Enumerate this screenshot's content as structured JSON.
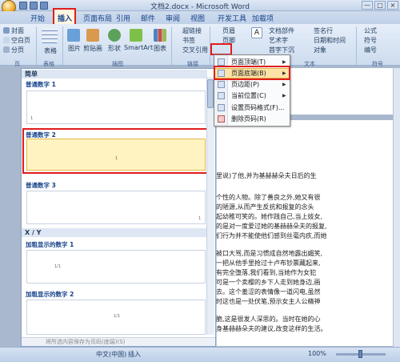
{
  "window": {
    "title": "文档2.docx - Microsoft Word",
    "controls": [
      "—",
      "□",
      "×"
    ]
  },
  "tabs": [
    "开始",
    "插入",
    "页面布局",
    "引用",
    "邮件",
    "审阅",
    "视图",
    "开发工具",
    "加载项"
  ],
  "ribbon": {
    "pages_group": [
      "封面",
      "空白页",
      "分页"
    ],
    "table_label": "表格",
    "illustrations": [
      "图片",
      "剪贴画",
      "形状",
      "SmartArt",
      "图表"
    ],
    "links_group": [
      "超链接",
      "书签",
      "交叉引用"
    ],
    "header_footer": [
      "页眉",
      "页脚"
    ],
    "text_group": [
      "文本框",
      "文档部件",
      "艺术字",
      "首字下沉"
    ],
    "text_right": [
      "签名行",
      "日期和时间",
      "对象"
    ],
    "symbols_group": [
      "公式",
      "符号",
      "编号"
    ],
    "group_labels": [
      "页",
      "表格",
      "插图",
      "链接",
      "文本",
      "符号"
    ]
  },
  "menu": {
    "items": [
      {
        "label": "页面顶端(T)",
        "arrow": "▶"
      },
      {
        "label": "页面底端(B)",
        "arrow": "▶"
      },
      {
        "label": "页边距(P)",
        "arrow": "▶"
      },
      {
        "label": "当前位置(C)",
        "arrow": "▶"
      },
      {
        "label": "设置页码格式(F)...",
        "arrow": ""
      },
      {
        "label": "删除页码(R)",
        "arrow": ""
      }
    ]
  },
  "gallery": {
    "header_simple": "简单",
    "header_xy": "X / Y",
    "items": [
      "普通数字 1",
      "普通数字 2",
      "普通数字 3",
      "加粗显示的数字 1",
      "加粗显示的数字 2"
    ],
    "footer": "将所选内容保存为页码(底端)(S)"
  },
  "document": {
    "lines": [
      "里说)了他,并为基赫赫朵夫日后的生",
      "",
      "个性的人物。除了善良之外,她又有很",
      "的陋源,从而产生反抗和报复的念头",
      "起幼稚可笑的。她作践自己,当上妓女,",
      "的是对一度爱过她的基赫赫朵夫的报复,",
      "们行为并不能使他们感到丝毫内疚,而她",
      "",
      "被口大骂,而是习惯成自然地露出媚笑,",
      "一把从他手里抢过十卢布钞票藏起来,",
      "有完全堕落,我们看到,当她作为女犯",
      "可是一个卖樱的乡下人走到她身边,画",
      "去。这个羞涩的表情像一道闪电,虽然",
      "时这也是一处伏笔,预示女主人公精神",
      "",
      "脆,这是很发人深思的。当时在她的心",
      "身基赫赫朵夫的建议,改变这样的生活。"
    ]
  },
  "status": {
    "lang": "中文(中国)",
    "mode": "插入",
    "zoom": "100%"
  }
}
